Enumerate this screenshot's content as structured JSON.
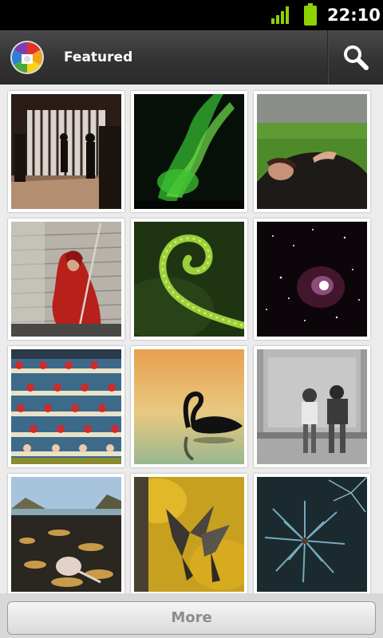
{
  "status_bar": {
    "time": "22:10",
    "signal_icon": "signal-bars-icon",
    "battery_icon": "battery-icon",
    "accent_color": "#8ed100"
  },
  "app_bar": {
    "title": "Featured",
    "logo_icon": "picasa-logo-icon",
    "search_icon": "search-icon"
  },
  "photos": [
    {
      "name": "photo-gate-silhouettes"
    },
    {
      "name": "photo-aurora"
    },
    {
      "name": "photo-woman-in-field"
    },
    {
      "name": "photo-red-cloaked-figure"
    },
    {
      "name": "photo-fern-spiral"
    },
    {
      "name": "photo-orion-nebula"
    },
    {
      "name": "photo-rowing-crews"
    },
    {
      "name": "photo-black-swan"
    },
    {
      "name": "photo-children-on-bench"
    },
    {
      "name": "photo-rocky-beach"
    },
    {
      "name": "photo-birds-autumn-leaves"
    },
    {
      "name": "photo-pine-needles"
    }
  ],
  "footer": {
    "more_label": "More"
  }
}
